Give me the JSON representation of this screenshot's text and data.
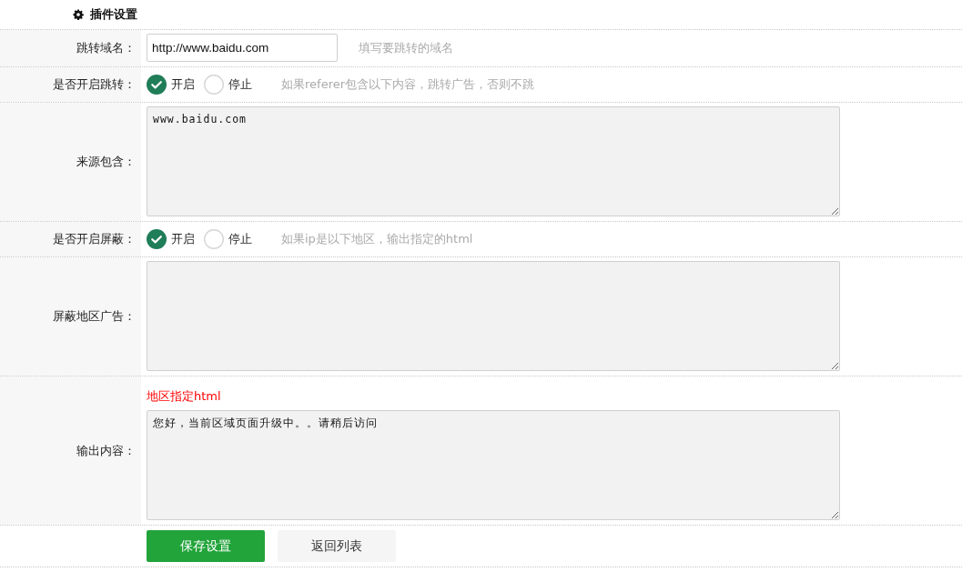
{
  "header": {
    "title": "插件设置"
  },
  "fields": [
    {
      "kind": "text",
      "label": "跳转域名：",
      "value": "http://www.baidu.com",
      "hint": "填写要跳转的域名"
    },
    {
      "kind": "radio",
      "label": "是否开启跳转：",
      "options": [
        {
          "label": "开启",
          "selected": true
        },
        {
          "label": "停止",
          "selected": false
        }
      ],
      "hint": "如果referer包含以下内容，跳转广告，否则不跳"
    },
    {
      "kind": "textarea",
      "label": "来源包含：",
      "value": "www.baidu.com"
    },
    {
      "kind": "radio",
      "label": "是否开启屏蔽：",
      "options": [
        {
          "label": "开启",
          "selected": true
        },
        {
          "label": "停止",
          "selected": false
        }
      ],
      "hint": "如果ip是以下地区，输出指定的html"
    },
    {
      "kind": "textarea",
      "label": "屏蔽地区广告："
    },
    {
      "kind": "textarea",
      "label": "输出内容：",
      "note": "地区指定html",
      "value": "您好，当前区域页面升级中。。请稍后访问"
    }
  ],
  "buttons": [
    {
      "kind": "primary",
      "label": "保存设置"
    },
    {
      "kind": "secondary",
      "label": "返回列表"
    }
  ]
}
